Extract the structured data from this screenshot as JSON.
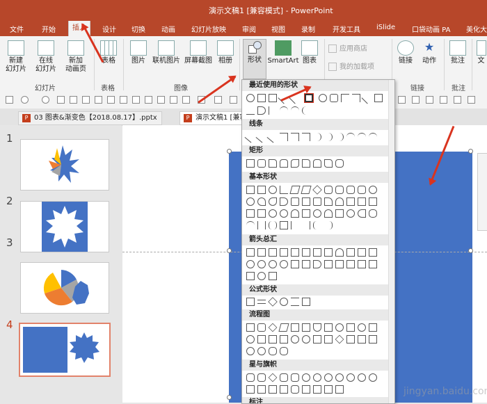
{
  "title": "演示文稿1 [兼容模式] - PowerPoint",
  "tabs": [
    "文件",
    "开始",
    "插入",
    "设计",
    "切换",
    "动画",
    "幻灯片放映",
    "审阅",
    "视图",
    "录制",
    "开发工具",
    "iSlide",
    "口袋动画 PA",
    "美化大"
  ],
  "ribbon": {
    "new_slide": "新建\n幻灯片",
    "online_slide": "在线\n幻灯片",
    "new_anim_page": "新加\n动画页",
    "table": "表格",
    "picture": "图片",
    "online_picture": "联机图片",
    "screenshot": "屏幕截图",
    "album": "相册",
    "shapes": "形状",
    "smartart": "SmartArt",
    "chart": "图表",
    "app_store": "应用商店",
    "my_addins": "我的加载项",
    "link": "链接",
    "action": "动作",
    "comment": "批注",
    "text": "文",
    "groups": {
      "slides": "幻灯片",
      "tables": "表格",
      "images": "图像",
      "links": "链接",
      "comments": "批注"
    }
  },
  "doc_tabs": [
    "03 图表&渐变色【2018.08.17】.pptx",
    "演示文稿1 [兼容"
  ],
  "slide_numbers": [
    "1",
    "2",
    "3",
    "4"
  ],
  "gallery_sections": [
    "最近使用的形状",
    "线条",
    "矩形",
    "基本形状",
    "箭头总汇",
    "公式形状",
    "流程图",
    "星与旗帜",
    "标注"
  ],
  "watermark": "jingyan.baidu.com",
  "colors": {
    "accent": "#b7472a",
    "slide_blue": "#4472c4",
    "arrow_red": "#d9341f",
    "selected_thumb": "#e2826a"
  }
}
